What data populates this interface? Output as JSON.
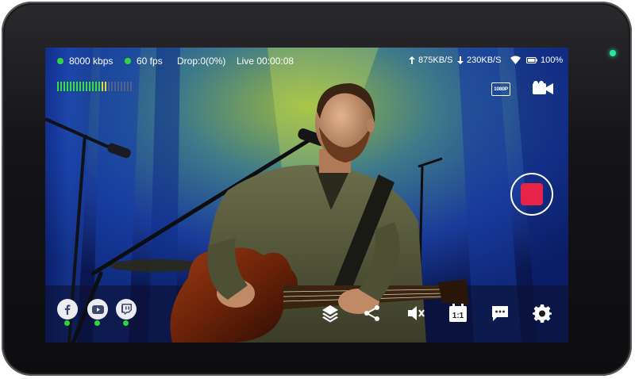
{
  "status": {
    "bitrate": "8000 kbps",
    "fps": "60 fps",
    "drop": "Drop:0(0%)",
    "live": "Live 00:00:08",
    "upload": "875KB/S",
    "download": "230KB/S",
    "battery": "100%"
  },
  "video": {
    "resolution": "1080P"
  },
  "audio_meter": {
    "level": 0.65
  },
  "platforms": [
    {
      "name": "facebook",
      "icon": "facebook-icon",
      "connected": true
    },
    {
      "name": "youtube",
      "icon": "youtube-icon",
      "connected": true
    },
    {
      "name": "twitch",
      "icon": "twitch-icon",
      "connected": true
    }
  ],
  "toolbar": {
    "aspect_label": "1:1",
    "icons": [
      "layers-icon",
      "switch-icon",
      "mute-icon",
      "aspect-icon",
      "comment-icon",
      "gear-icon"
    ]
  },
  "colors": {
    "record": "#e8234a",
    "status_ok": "#2fd63c",
    "indicator_led": "#2ce6a0"
  }
}
